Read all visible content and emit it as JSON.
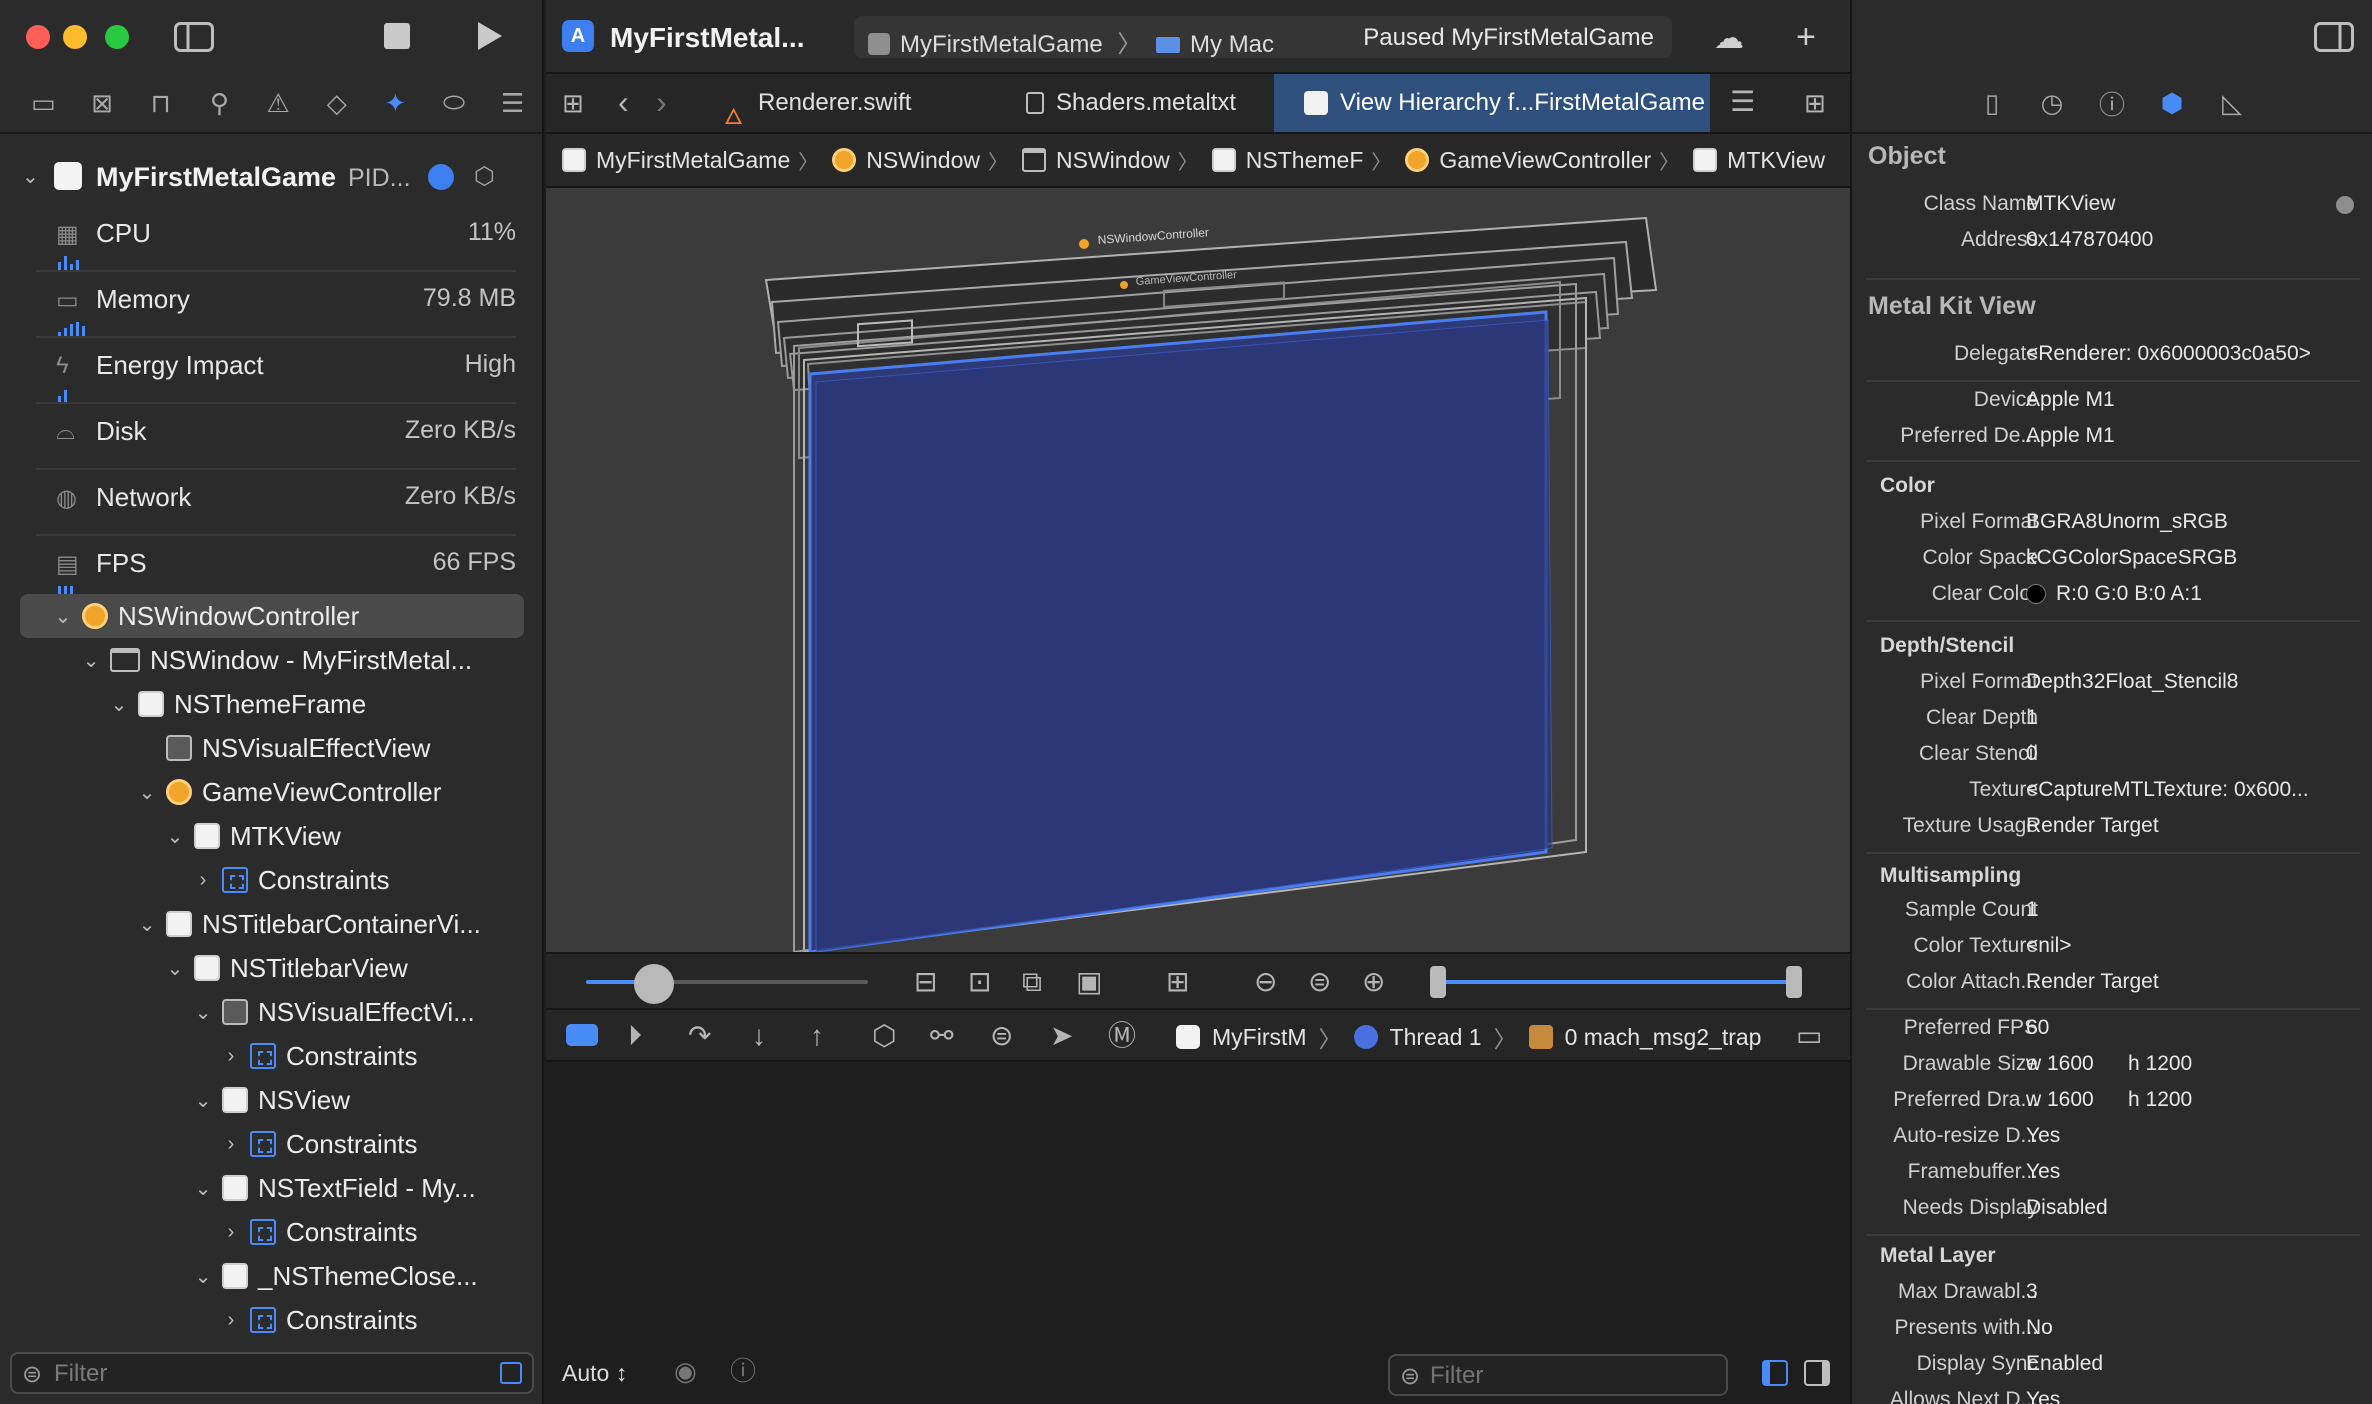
{
  "toolbar": {
    "app_title": "MyFirstMetal...",
    "scheme_target": "MyFirstMetalGame",
    "scheme_device": "My Mac",
    "status": "Paused MyFirstMetalGame"
  },
  "tabs": [
    {
      "label": "Renderer.swift"
    },
    {
      "label": "Shaders.metaltxt"
    },
    {
      "label": "View Hierarchy f...FirstMetalGame"
    }
  ],
  "breadcrumbs": [
    "MyFirstMetalGame",
    "NSWindow",
    "NSWindow",
    "NSThemeF",
    "GameViewController",
    "MTKView"
  ],
  "process": {
    "name": "MyFirstMetalGame",
    "pid": "PID..."
  },
  "gauges": [
    {
      "name": "CPU",
      "value": "11%",
      "icon": "cpu-icon"
    },
    {
      "name": "Memory",
      "value": "79.8 MB",
      "icon": "memory-icon"
    },
    {
      "name": "Energy Impact",
      "value": "High",
      "icon": "energy-icon"
    },
    {
      "name": "Disk",
      "value": "Zero KB/s",
      "icon": "disk-icon"
    },
    {
      "name": "Network",
      "value": "Zero KB/s",
      "icon": "network-icon"
    },
    {
      "name": "FPS",
      "value": "66 FPS",
      "icon": "fps-icon"
    }
  ],
  "tree": [
    {
      "label": "NSWindowController",
      "icon": "orange",
      "depth": 0,
      "open": true,
      "selected": true
    },
    {
      "label": "NSWindow - MyFirstMetal...",
      "icon": "window",
      "depth": 1,
      "open": true
    },
    {
      "label": "NSThemeFrame",
      "icon": "white",
      "depth": 2,
      "open": true
    },
    {
      "label": "NSVisualEffectView",
      "icon": "effect",
      "depth": 3,
      "open": null
    },
    {
      "label": "GameViewController",
      "icon": "orange",
      "depth": 3,
      "open": true
    },
    {
      "label": "MTKView",
      "icon": "white",
      "depth": 4,
      "open": true
    },
    {
      "label": "Constraints",
      "icon": "constraint",
      "depth": 5,
      "open": false
    },
    {
      "label": "NSTitlebarContainerVi...",
      "icon": "white",
      "depth": 3,
      "open": true
    },
    {
      "label": "NSTitlebarView",
      "icon": "white",
      "depth": 4,
      "open": true
    },
    {
      "label": "NSVisualEffectVi...",
      "icon": "effect",
      "depth": 5,
      "open": true
    },
    {
      "label": "Constraints",
      "icon": "constraint",
      "depth": 6,
      "open": false
    },
    {
      "label": "NSView",
      "icon": "white",
      "depth": 5,
      "open": true
    },
    {
      "label": "Constraints",
      "icon": "constraint",
      "depth": 6,
      "open": false
    },
    {
      "label": "NSTextField - My...",
      "icon": "white",
      "depth": 5,
      "open": true
    },
    {
      "label": "Constraints",
      "icon": "constraint",
      "depth": 6,
      "open": false
    },
    {
      "label": "_NSThemeClose...",
      "icon": "white",
      "depth": 5,
      "open": true
    },
    {
      "label": "Constraints",
      "icon": "constraint",
      "depth": 6,
      "open": false
    }
  ],
  "left_filter": {
    "placeholder": "Filter"
  },
  "canvas": {
    "label1": "NSWindowController",
    "label2": "GameViewController"
  },
  "debug": {
    "target": "MyFirstM",
    "thread": "Thread 1",
    "frame": "0 mach_msg2_trap"
  },
  "console": {
    "mode": "Auto ↕",
    "filter_placeholder": "Filter"
  },
  "inspector": {
    "object_title": "Object",
    "class_name_k": "Class Name",
    "class_name_v": "MTKView",
    "address_k": "Address",
    "address_v": "0x147870400",
    "mkv_title": "Metal Kit View",
    "delegate_k": "Delegate",
    "delegate_v": "<Renderer: 0x6000003c0a50>",
    "device_k": "Device",
    "device_v": "Apple M1",
    "pref_dev_k": "Preferred De...",
    "pref_dev_v": "Apple M1",
    "color_title": "Color",
    "pixel_format_k": "Pixel Format",
    "pixel_format_v": "BGRA8Unorm_sRGB",
    "color_space_k": "Color Space",
    "color_space_v": "kCGColorSpaceSRGB",
    "clear_color_k": "Clear Color",
    "clear_color_v": "R:0 G:0 B:0 A:1",
    "depth_title": "Depth/Stencil",
    "ds_pixel_format_k": "Pixel Format",
    "ds_pixel_format_v": "Depth32Float_Stencil8",
    "clear_depth_k": "Clear Depth",
    "clear_depth_v": "1",
    "clear_stencil_k": "Clear Stencil",
    "clear_stencil_v": "0",
    "texture_k": "Texture",
    "texture_v": "<CaptureMTLTexture: 0x600...",
    "texture_usage_k": "Texture Usage",
    "texture_usage_v": "Render Target",
    "ms_title": "Multisampling",
    "sample_count_k": "Sample Count",
    "sample_count_v": "1",
    "color_texture_k": "Color Texture",
    "color_texture_v": "<nil>",
    "color_attach_k": "Color Attach...",
    "color_attach_v": "Render Target",
    "pref_fps_k": "Preferred FPS",
    "pref_fps_v": "60",
    "drawable_size_k": "Drawable Size",
    "drawable_w": "w  1600",
    "drawable_h": "h  1200",
    "pref_dra_k": "Preferred Dra...",
    "pref_dra_w": "w  1600",
    "pref_dra_h": "h  1200",
    "auto_resize_k": "Auto-resize D...",
    "auto_resize_v": "Yes",
    "framebuffer_k": "Framebuffer...",
    "framebuffer_v": "Yes",
    "needs_display_k": "Needs Display",
    "needs_display_v": "Disabled",
    "ml_title": "Metal Layer",
    "max_drawabl_k": "Max Drawabl...",
    "max_drawabl_v": "3",
    "presents_k": "Presents with...",
    "presents_v": "No",
    "display_sync_k": "Display Sync",
    "display_sync_v": "Enabled",
    "allows_next_k": "Allows Next D...",
    "allows_next_v": "Yes"
  },
  "colors": {
    "accent": "#4a8cf7",
    "selection": "#2f4f7c",
    "canvas_bg": "#3b3b3b",
    "view_fill": "#2e3a78"
  }
}
